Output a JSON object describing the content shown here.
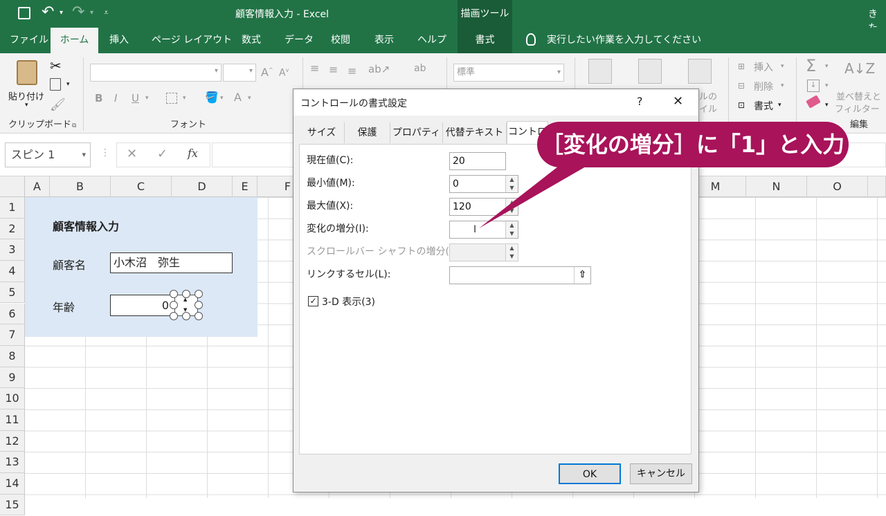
{
  "titlebar": {
    "doc_title": "顧客情報入力 - Excel",
    "tool_context": "描画ツール",
    "user": "きた"
  },
  "tabs": [
    "ファイル",
    "ホーム",
    "挿入",
    "ページ レイアウト",
    "数式",
    "データ",
    "校閲",
    "表示",
    "ヘルプ",
    "書式"
  ],
  "tell_me": "実行したい作業を入力してください",
  "ribbon": {
    "paste": "貼り付け",
    "clipboard": "クリップボード",
    "font": "フォント",
    "number_format": "標準",
    "insert": "挿入",
    "delete": "削除",
    "format": "書式",
    "sort_filter_1": "並べ替えと",
    "sort_filter_2": "フィルター",
    "editing": "編集",
    "style_partial_1": "ルの",
    "style_partial_2": "イル"
  },
  "namebox": "スピン 1",
  "columns": [
    "A",
    "B",
    "C",
    "D",
    "E",
    "F",
    "M",
    "N",
    "O"
  ],
  "rows": [
    "1",
    "2",
    "3",
    "4",
    "5",
    "6",
    "7",
    "8",
    "9",
    "10",
    "11",
    "12",
    "13",
    "14",
    "15"
  ],
  "sheet": {
    "title": "顧客情報入力",
    "customer_label": "顧客名",
    "customer_value": "小木沼　弥生",
    "age_label": "年齢",
    "age_value": "0"
  },
  "dialog": {
    "title": "コントロールの書式設定",
    "help": "?",
    "close": "✕",
    "tabs": [
      "サイズ",
      "保護",
      "プロパティ",
      "代替テキスト",
      "コントロ"
    ],
    "fields": [
      {
        "label": "現在値(C):",
        "value": "20"
      },
      {
        "label": "最小値(M):",
        "value": "0"
      },
      {
        "label": "最大値(X):",
        "value": "120"
      },
      {
        "label": "変化の増分(I):",
        "value": ""
      },
      {
        "label": "スクロールバー シャフトの増分(P):",
        "value": ""
      },
      {
        "label": "リンクするセル(L):",
        "value": ""
      }
    ],
    "checkbox": "3-D 表示(3)",
    "ok": "OK",
    "cancel": "キャンセル"
  },
  "callout": "［変化の増分］に「1」と入力",
  "colors": {
    "excel_green": "#217346",
    "callout": "#a8135a",
    "form_bg": "#dce8f5"
  }
}
